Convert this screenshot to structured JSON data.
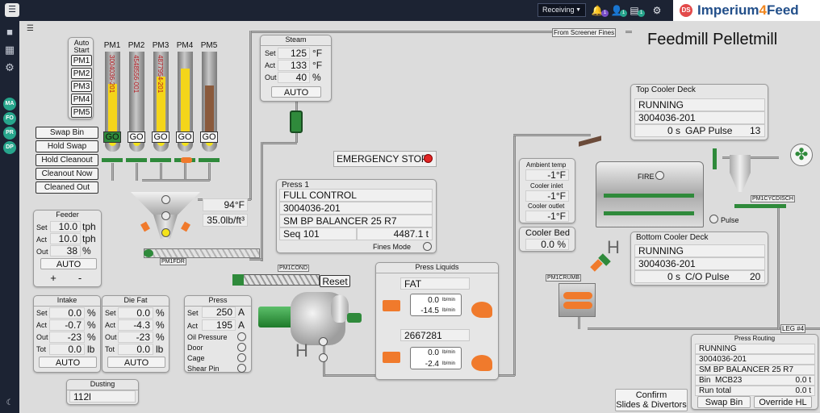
{
  "topbar": {
    "menu_icon": "hamburger-icon",
    "site": "Receiving",
    "badges": [
      "1",
      "1",
      "1"
    ],
    "avatar": "DS",
    "brand_left": "Imperium",
    "brand_num": "4",
    "brand_right": "Feed",
    "accent": "#224f8a",
    "brand_accent": "#f0861e"
  },
  "rail": {
    "users": [
      "MA",
      "FO",
      "PR",
      "DP"
    ]
  },
  "page_title": "Feedmill Pelletmill",
  "route_labels": {
    "from_screener": "From Screener Fines",
    "leg4": "LEG #4",
    "pm1fdr": "PM1FDR",
    "pm1cond": "PM1COND",
    "pm1crumb": "PM1CRUMB",
    "pm1cycdisch": "PM1CYCDISCH"
  },
  "auto_start": {
    "title": "Auto Start",
    "buttons": [
      "PM1",
      "PM2",
      "PM3",
      "PM4",
      "PM5"
    ]
  },
  "bins": [
    {
      "label": "PM1",
      "number": "3004036-201",
      "fill": 0.62,
      "fill_color": "#f4d51a",
      "go": "GO",
      "active": true
    },
    {
      "label": "PM2",
      "number": "4548556-001",
      "fill": 0.0,
      "fill_color": "#f4d51a",
      "go": "GO",
      "active": false
    },
    {
      "label": "PM3",
      "number": "4877954-201",
      "fill": 0.72,
      "fill_color": "#f4d51a",
      "go": "GO",
      "active": false
    },
    {
      "label": "PM4",
      "number": "",
      "fill": 0.82,
      "fill_color": "#f4d51a",
      "go": "GO",
      "active": false
    },
    {
      "label": "PM5",
      "number": "",
      "fill": 0.6,
      "fill_color": "#8a5a3c",
      "go": "GO",
      "active": false
    }
  ],
  "bin_actions": [
    "Swap Bin",
    "Hold Swap",
    "Hold Cleanout",
    "Cleanout Now",
    "Cleaned Out"
  ],
  "hopper": {
    "temp": "94",
    "temp_unit": "°F",
    "density": "35.0",
    "density_unit": "lb/ft³"
  },
  "steam": {
    "title": "Steam",
    "rows": [
      {
        "label": "Set",
        "value": "125",
        "unit": "°F"
      },
      {
        "label": "Act",
        "value": "133",
        "unit": "°F"
      },
      {
        "label": "Out",
        "value": "40",
        "unit": "%"
      }
    ],
    "auto": "AUTO"
  },
  "emergency": "EMERGENCY STOP",
  "press1": {
    "title": "Press 1",
    "mode": "FULL CONTROL",
    "order": "3004036-201",
    "product": "SM BP BALANCER 25 R7",
    "seq_label": "Seq",
    "seq": "101",
    "total": "4487.1",
    "total_unit": "t",
    "fines_mode": "Fines Mode"
  },
  "feeder": {
    "title": "Feeder",
    "rows": [
      {
        "label": "Set",
        "value": "10.0",
        "unit": "tph"
      },
      {
        "label": "Act",
        "value": "10.0",
        "unit": "tph"
      },
      {
        "label": "Out",
        "value": "38",
        "unit": "%"
      }
    ],
    "auto": "AUTO",
    "plus": "+",
    "minus": "-"
  },
  "intake": {
    "title": "Intake",
    "rows": [
      {
        "label": "Set",
        "value": "0.0",
        "unit": "%"
      },
      {
        "label": "Act",
        "value": "-0.7",
        "unit": "%"
      },
      {
        "label": "Out",
        "value": "-23",
        "unit": "%"
      },
      {
        "label": "Tot",
        "value": "0.0",
        "unit": "lb"
      }
    ],
    "auto": "AUTO"
  },
  "diefat": {
    "title": "Die Fat",
    "rows": [
      {
        "label": "Set",
        "value": "0.0",
        "unit": "%"
      },
      {
        "label": "Act",
        "value": "-4.3",
        "unit": "%"
      },
      {
        "label": "Out",
        "value": "-23",
        "unit": "%"
      },
      {
        "label": "Tot",
        "value": "0.0",
        "unit": "lb"
      }
    ],
    "auto": "AUTO"
  },
  "press": {
    "title": "Press",
    "rows": [
      {
        "label": "Set",
        "value": "250",
        "unit": "A"
      },
      {
        "label": "Act",
        "value": "195",
        "unit": "A"
      }
    ],
    "indicators": [
      "Oil Pressure",
      "Door",
      "Cage",
      "Shear Pin"
    ]
  },
  "reset": "Reset",
  "dusting": {
    "title": "Dusting",
    "value": "112l"
  },
  "liquids": {
    "title": "Press Liquids",
    "l1_name": "FAT",
    "l1_v1": "0.0",
    "l1_v2": "-14.5",
    "unit": "lb/min",
    "l2_name": "2667281",
    "l2_v1": "0.0",
    "l2_v2": "-2.4"
  },
  "ambient": {
    "ambient_label": "Ambient temp",
    "ambient": "-1",
    "u": "°F",
    "inlet_label": "Cooler inlet",
    "inlet": "-1",
    "outlet_label": "Cooler outlet",
    "outlet": "-1"
  },
  "coolerbed": {
    "label": "Cooler Bed",
    "value": "0.0",
    "unit": "%"
  },
  "top_cooler": {
    "title": "Top Cooler Deck",
    "status": "RUNNING",
    "order": "3004036-201",
    "time": "0 s",
    "pulse_label": "GAP Pulse",
    "pulse": "13"
  },
  "bottom_cooler": {
    "title": "Bottom Cooler Deck",
    "status": "RUNNING",
    "order": "3004036-201",
    "time": "0 s",
    "pulse_label": "C/O Pulse",
    "pulse": "20"
  },
  "fire": "FIRE",
  "pulse": "Pulse",
  "routing": {
    "title": "Press Routing",
    "status": "RUNNING",
    "order": "3004036-201",
    "product": "SM BP BALANCER 25 R7",
    "bin_label": "Bin",
    "bin": "MCB23",
    "bin_val": "0.0 t",
    "run_label": "Run total",
    "run_val": "0.0 t",
    "swap": "Swap Bin",
    "override": "Override HL"
  },
  "confirm": {
    "line1": "Confirm",
    "line2": "Slides & Divertors"
  }
}
